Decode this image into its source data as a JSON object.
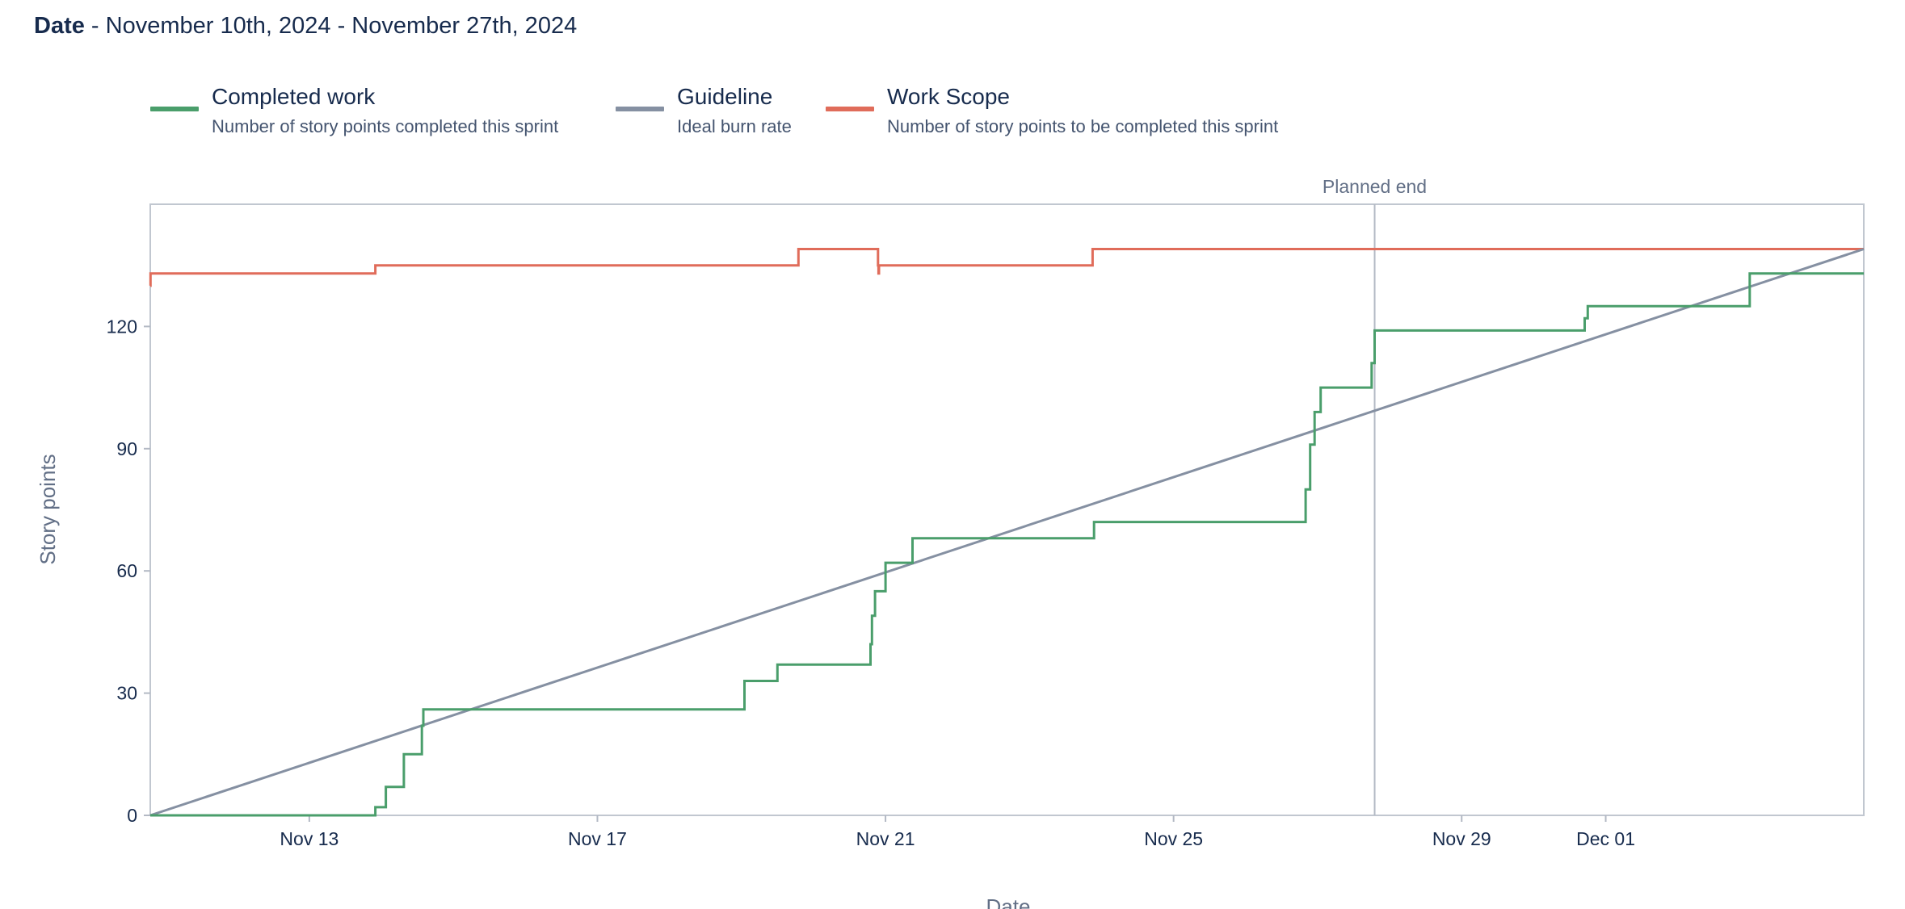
{
  "header": {
    "label": "Date",
    "range": " - November 10th, 2024 - November 27th, 2024"
  },
  "legend": [
    {
      "name": "Completed work",
      "description": "Number of story points completed this sprint",
      "color": "#4a9e6b"
    },
    {
      "name": "Guideline",
      "description": "Ideal burn rate",
      "color": "#8590a2"
    },
    {
      "name": "Work Scope",
      "description": "Number of story points to be completed this sprint",
      "color": "#e06c5a"
    }
  ],
  "chart_data": {
    "type": "line",
    "xlabel": "Date",
    "ylabel": "Story points",
    "x_ticks": [
      "Nov 13",
      "Nov 17",
      "Nov 21",
      "Nov 25",
      "Nov 29",
      "Dec 01"
    ],
    "y_ticks": [
      0,
      30,
      60,
      90,
      120
    ],
    "xlim": [
      "2024-11-10 19:00",
      "2024-12-04 14:00"
    ],
    "ylim": [
      0,
      150
    ],
    "annotations": [
      {
        "label": "Planned end",
        "x": "2024-11-27 19:00"
      }
    ],
    "series": [
      {
        "name": "Work Scope",
        "color": "#e06c5a",
        "step": true,
        "points": [
          [
            "2024-11-10 19:00",
            130
          ],
          [
            "2024-11-10 19:05",
            133
          ],
          [
            "2024-11-13 22:00",
            135
          ],
          [
            "2024-11-19 19:00",
            139
          ],
          [
            "2024-11-20 21:30",
            135
          ],
          [
            "2024-11-20 21:40",
            133
          ],
          [
            "2024-11-20 21:50",
            135
          ],
          [
            "2024-11-23 21:00",
            139
          ],
          [
            "2024-12-04 14:00",
            139
          ]
        ]
      },
      {
        "name": "Guideline",
        "color": "#8590a2",
        "step": false,
        "points": [
          [
            "2024-11-10 19:00",
            0
          ],
          [
            "2024-12-04 14:00",
            139
          ]
        ]
      },
      {
        "name": "Completed work",
        "color": "#4a9e6b",
        "step": true,
        "points": [
          [
            "2024-11-10 19:00",
            0
          ],
          [
            "2024-11-13 22:00",
            2
          ],
          [
            "2024-11-14 01:30",
            7
          ],
          [
            "2024-11-14 07:30",
            15
          ],
          [
            "2024-11-14 13:30",
            22
          ],
          [
            "2024-11-14 14:00",
            26
          ],
          [
            "2024-11-19 01:00",
            33
          ],
          [
            "2024-11-19 12:00",
            37
          ],
          [
            "2024-11-20 19:00",
            42
          ],
          [
            "2024-11-20 19:30",
            49
          ],
          [
            "2024-11-20 20:30",
            55
          ],
          [
            "2024-11-21 00:00",
            62
          ],
          [
            "2024-11-21 09:00",
            68
          ],
          [
            "2024-11-23 21:30",
            72
          ],
          [
            "2024-11-26 20:00",
            80
          ],
          [
            "2024-11-26 21:30",
            91
          ],
          [
            "2024-11-26 23:00",
            99
          ],
          [
            "2024-11-27 01:00",
            105
          ],
          [
            "2024-11-27 18:00",
            111
          ],
          [
            "2024-11-27 19:00",
            119
          ],
          [
            "2024-11-30 17:00",
            122
          ],
          [
            "2024-11-30 18:00",
            125
          ],
          [
            "2024-12-03 00:00",
            133
          ],
          [
            "2024-12-04 14:00",
            133
          ]
        ]
      }
    ]
  }
}
